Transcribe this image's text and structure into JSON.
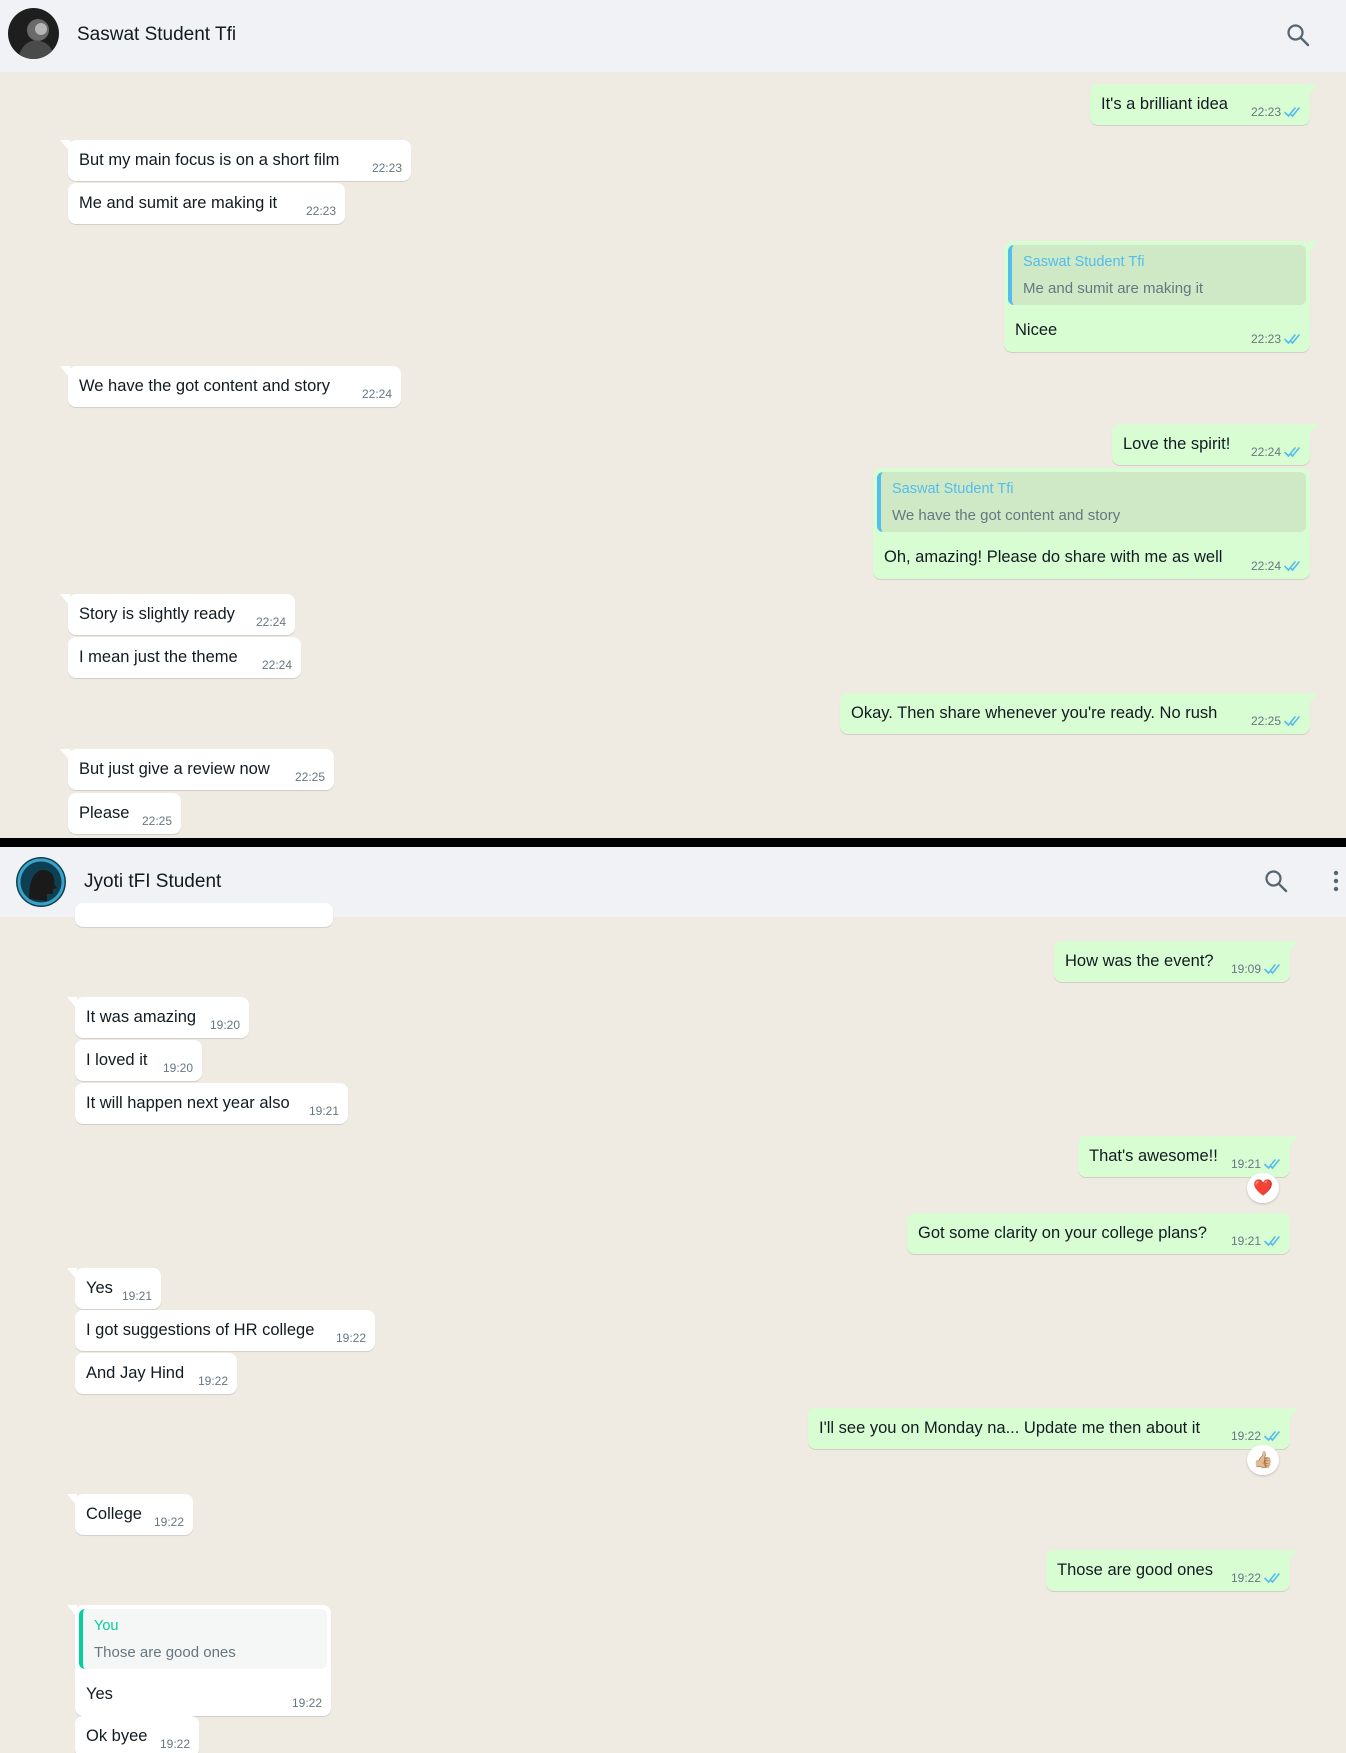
{
  "chat1": {
    "contact_name": "Saswat Student Tfi",
    "messages": [
      {
        "text": "It's a brilliant idea",
        "time": "22:23"
      },
      {
        "text": "But my main focus is on a short film",
        "time": "22:23"
      },
      {
        "text": "Me and sumit are making it",
        "time": "22:23"
      },
      {
        "quote_name": "Saswat Student Tfi",
        "quote_text": "Me and sumit are making it",
        "text": "Nicee",
        "time": "22:23"
      },
      {
        "text": "We have the got content and story",
        "time": "22:24"
      },
      {
        "text": "Love the spirit!",
        "time": "22:24"
      },
      {
        "quote_name": "Saswat Student Tfi",
        "quote_text": "We have the got content and story",
        "text": "Oh, amazing! Please do share with me as well",
        "time": "22:24"
      },
      {
        "text": "Story is slightly ready",
        "time": "22:24"
      },
      {
        "text": "I mean just the theme",
        "time": "22:24"
      },
      {
        "text": "Okay. Then share whenever you're ready. No rush",
        "time": "22:25"
      },
      {
        "text": "But just give a review now",
        "time": "22:25"
      },
      {
        "text": "Please",
        "time": "22:25"
      }
    ]
  },
  "chat2": {
    "contact_name": "Jyoti tFI Student",
    "messages": [
      {
        "text": "How was the event?",
        "time": "19:09"
      },
      {
        "text": "It was amazing",
        "time": "19:20"
      },
      {
        "text": "I loved it",
        "time": "19:20"
      },
      {
        "text": "It will happen next year also",
        "time": "19:21"
      },
      {
        "text": "That's awesome!!",
        "time": "19:21",
        "reaction": "❤️"
      },
      {
        "text": "Got some clarity on your college plans?",
        "time": "19:21"
      },
      {
        "text": "Yes",
        "time": "19:21"
      },
      {
        "text": "I got suggestions of HR college",
        "time": "19:22"
      },
      {
        "text": "And Jay Hind",
        "time": "19:22"
      },
      {
        "text": "I'll see you on Monday na... Update me then about it",
        "time": "19:22",
        "reaction": "👍🏼"
      },
      {
        "text": "College",
        "time": "19:22"
      },
      {
        "text": "Those are good ones",
        "time": "19:22"
      },
      {
        "quote_name": "You",
        "quote_text": "Those are good ones",
        "text": "Yes",
        "time": "19:22"
      },
      {
        "text": "Ok byee",
        "time": "19:22"
      }
    ]
  },
  "icons": {
    "search": "search-icon",
    "menu": "kebab-menu-icon",
    "read_receipt": "double-check-icon"
  },
  "colors": {
    "chat_bg": "#efeae2",
    "header_bg": "#f0f2f5",
    "outgoing_bubble": "#d9fdd3",
    "incoming_bubble": "#ffffff",
    "read_tick": "#53bdeb",
    "quote_accent_other": "#53bdeb",
    "quote_accent_you": "#06cf9c"
  }
}
